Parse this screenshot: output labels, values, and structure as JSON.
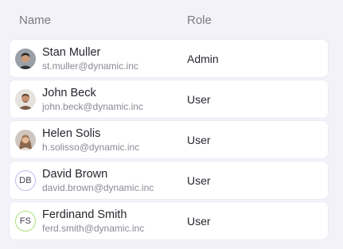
{
  "table": {
    "headers": {
      "name": "Name",
      "role": "Role"
    },
    "rows": [
      {
        "name": "Stan Muller",
        "email": "st.muller@dynamic.inc",
        "role": "Admin",
        "avatar": {
          "type": "photo",
          "icon": "avatar-photo-icon"
        }
      },
      {
        "name": "John Beck",
        "email": "john.beck@dynamic.inc",
        "role": "User",
        "avatar": {
          "type": "photo",
          "icon": "avatar-photo-icon"
        }
      },
      {
        "name": "Helen Solis",
        "email": "h.solisso@dynamic.inc",
        "role": "User",
        "avatar": {
          "type": "photo",
          "icon": "avatar-photo-icon"
        }
      },
      {
        "name": "David Brown",
        "email": "david.brown@dynamic.inc",
        "role": "User",
        "avatar": {
          "type": "initials",
          "initials": "DB",
          "ring_color": "#c9b7ec"
        }
      },
      {
        "name": "Ferdinand Smith",
        "email": "ferd.smith@dynamic.inc",
        "role": "User",
        "avatar": {
          "type": "initials",
          "initials": "FS",
          "ring_color": "#a9e07d"
        }
      }
    ]
  },
  "colors": {
    "background": "#f4f2f9",
    "row_background": "#ffffff",
    "header_text": "#7b7b86",
    "primary_text": "#26262e",
    "secondary_text": "#8a8a95"
  }
}
